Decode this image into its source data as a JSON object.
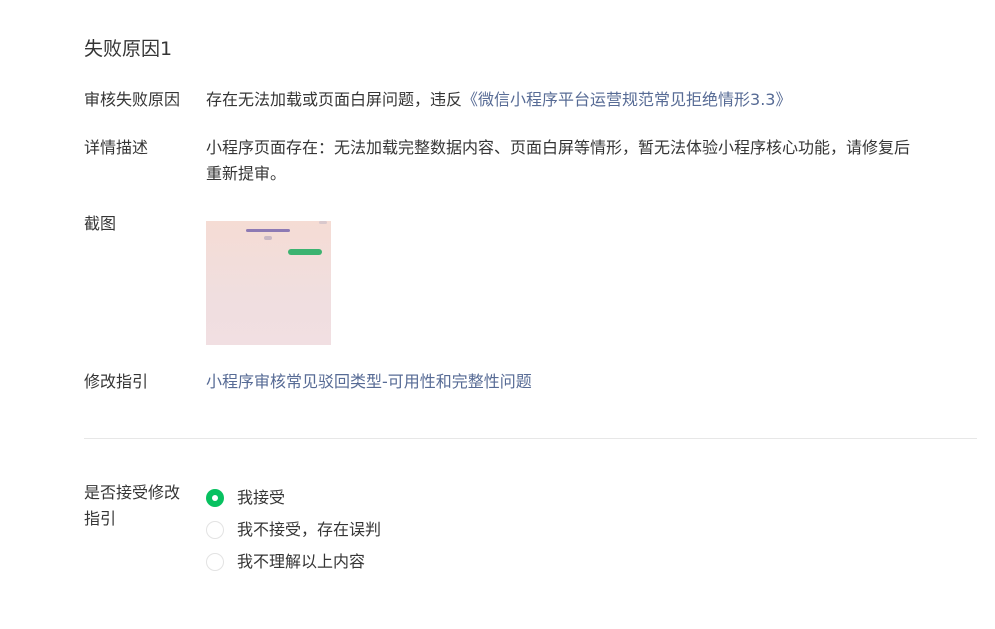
{
  "section_title": "失败原因1",
  "audit_reason": {
    "label": "审核失败原因",
    "text": "存在无法加载或页面白屏问题，违反",
    "link": "《微信小程序平台运营规范常见拒绝情形3.3》"
  },
  "detail": {
    "label": "详情描述",
    "line1": "小程序页面存在：无法加载完整数据内容、页面白屏等情形，暂无法体验小程序核心功能，请修复后",
    "line2": "重新提审。"
  },
  "screenshot": {
    "label": "截图"
  },
  "guide": {
    "label": "修改指引",
    "link": "小程序审核常见驳回类型-可用性和完整性问题"
  },
  "accept": {
    "label_line1": "是否接受修改",
    "label_line2": "指引",
    "options": [
      {
        "label": "我接受",
        "checked": true
      },
      {
        "label": "我不接受，存在误判",
        "checked": false
      },
      {
        "label": "我不理解以上内容",
        "checked": false
      }
    ]
  },
  "colors": {
    "link": "#576b95",
    "radio_checked": "#07c160",
    "text": "#353535",
    "divider": "#e7e7e7"
  }
}
